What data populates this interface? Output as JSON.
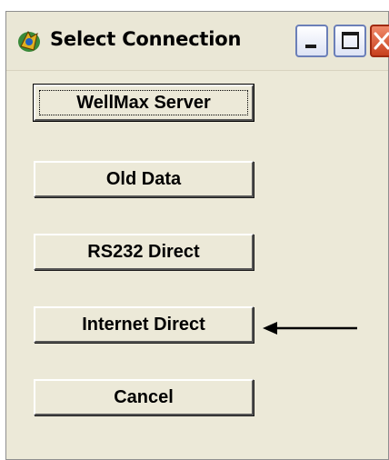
{
  "window": {
    "title": "Select Connection",
    "icon": "app-icon",
    "controls": [
      "minimize-icon",
      "maximize-icon",
      "close-icon"
    ]
  },
  "buttons": [
    {
      "id": "wellmax-server",
      "label": "WellMax Server",
      "default": true
    },
    {
      "id": "old-data",
      "label": "Old Data"
    },
    {
      "id": "rs232-direct",
      "label": "RS232 Direct"
    },
    {
      "id": "internet-direct",
      "label": "Internet Direct"
    },
    {
      "id": "cancel",
      "label": "Cancel"
    }
  ],
  "annotation": {
    "arrow_points_to": "internet-direct",
    "icon": "arrow-left-icon"
  },
  "colors": {
    "window_bg": "#ece9d8",
    "close_button": "#d14a26",
    "caption_border": "#6b7fb8"
  }
}
